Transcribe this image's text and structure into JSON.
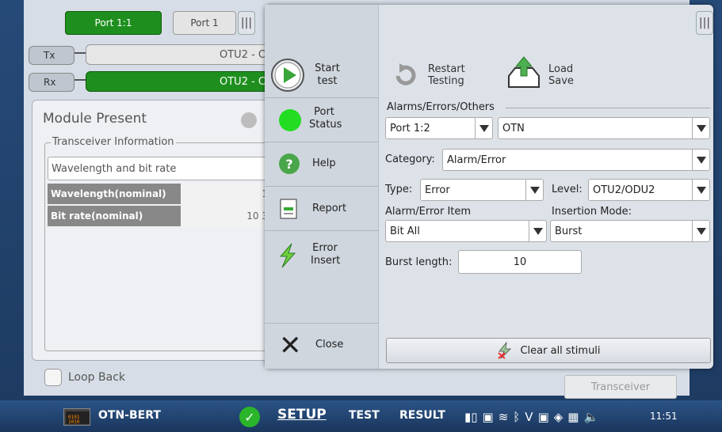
{
  "ports": {
    "active": "Port 1:1",
    "inactive": "Port 1"
  },
  "tx": {
    "label": "Tx",
    "value": "OTU2 - C"
  },
  "rx": {
    "label": "Rx",
    "value": "OTU2 - C"
  },
  "module": {
    "title": "Module Present",
    "transceiver_info": "Transceiver Information",
    "wavelength_bitrate": "Wavelength and bit rate",
    "rows": [
      {
        "label": "Wavelength(nominal)",
        "value": "1"
      },
      {
        "label": "Bit rate(nominal)",
        "value": "10 3"
      }
    ],
    "loop_back": "Loop Back"
  },
  "transceiver_button": "Transceiver",
  "menu": {
    "start_test": "Start test",
    "port_status": "Port Status",
    "help": "Help",
    "report": "Report",
    "error_insert": "Error Insert",
    "close": "Close"
  },
  "actions": {
    "restart": "Restart Testing",
    "load_save": "Load Save"
  },
  "alarms": {
    "section_title": "Alarms/Errors/Others",
    "port": "Port 1:2",
    "protocol": "OTN",
    "category_label": "Category:",
    "category": "Alarm/Error",
    "type_label": "Type:",
    "type": "Error",
    "level_label": "Level:",
    "level": "OTU2/ODU2",
    "item_label": "Alarm/Error Item",
    "item": "Bit All",
    "mode_label": "Insertion Mode:",
    "mode": "Burst",
    "burst_label": "Burst length:",
    "burst": "10",
    "clear": "Clear all stimuli"
  },
  "bottom": {
    "app": "OTN-BERT",
    "setup": "SETUP",
    "test": "TEST",
    "result": "RESULT",
    "time": "11:51"
  },
  "colors": {
    "green": "#1e8f1e",
    "status_green": "#22dd22",
    "nav": "#2c5487"
  }
}
